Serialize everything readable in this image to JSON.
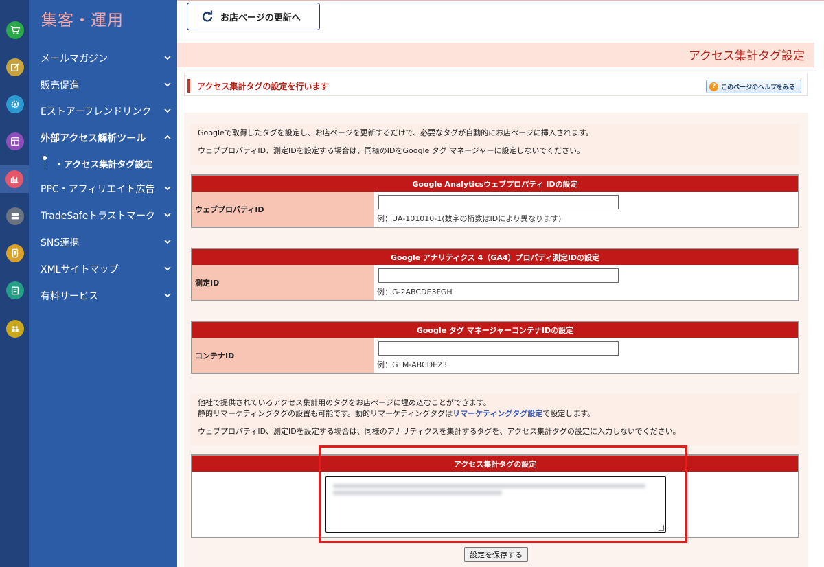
{
  "sidebar": {
    "title": "集客・運用",
    "items": [
      {
        "label": "メールマガジン",
        "expanded": false
      },
      {
        "label": "販売促進",
        "expanded": false
      },
      {
        "label": "Eストアーフレンドリンク",
        "expanded": false
      },
      {
        "label": "外部アクセス解析ツール",
        "expanded": true
      },
      {
        "label": "PPC・アフィリエイト広告",
        "expanded": false
      },
      {
        "label": "TradeSafeトラストマーク",
        "expanded": false
      },
      {
        "label": "SNS連携",
        "expanded": false
      },
      {
        "label": "XMLサイトマップ",
        "expanded": false
      },
      {
        "label": "有料サービス",
        "expanded": false
      }
    ],
    "active_sub": "・アクセス集計タグ設定"
  },
  "rail_icons": [
    {
      "name": "cart-icon",
      "color": "#2aa84a"
    },
    {
      "name": "edit-icon",
      "color": "#c8a23a"
    },
    {
      "name": "gear-icon",
      "color": "#2a9ad0"
    },
    {
      "name": "layout-icon",
      "color": "#8e4fb8"
    },
    {
      "name": "bar-chart-icon",
      "color": "#e5566a"
    },
    {
      "name": "server-icon",
      "color": "#6b7380"
    },
    {
      "name": "mobile-icon",
      "color": "#d9a128"
    },
    {
      "name": "clipboard-icon",
      "color": "#25a086"
    },
    {
      "name": "users-icon",
      "color": "#c9a81e"
    }
  ],
  "toolbar": {
    "refresh_label": "お店ページの更新へ"
  },
  "page": {
    "heading": "アクセス集計タグ設定",
    "intro": "アクセス集計タグの設定を行います",
    "help_label": "このページのヘルプをみる"
  },
  "notice1": {
    "line1": "Googleで取得したタグを設定し、お店ページを更新するだけで、必要なタグが自動的にお店ページに挿入されます。",
    "line2": "ウェブプロパティID、測定IDを設定する場合は、同様のIDをGoogle タグ マネージャーに設定しないでください。"
  },
  "sections": {
    "ua": {
      "title": "Google Analyticsウェブプロパティ IDの設定",
      "label": "ウェブプロパティID",
      "value": "",
      "example": "例：UA-101010-1(数字の桁数はIDにより異なります)"
    },
    "ga4": {
      "title": "Google アナリティクス 4（GA4）プロパティ測定IDの設定",
      "label": "測定ID",
      "value": "",
      "example": "例：G-2ABCDE3FGH"
    },
    "gtm": {
      "title": "Google タグ マネージャーコンテナIDの設定",
      "label": "コンテナID",
      "value": "",
      "example": "例：GTM-ABCDE23"
    }
  },
  "notice2": {
    "line1": "他社で提供されているアクセス集計用のタグをお店ページに埋め込むことができます。",
    "line2_pre": "静的リマーケティングタグの設置も可能です。動的リマーケティングタグは",
    "line2_link": "リマーケティングタグ設定",
    "line2_post": "で設定します。",
    "line3": "ウェブプロパティID、測定IDを設定する場合は、同様のアナリティクスを集計するタグを、アクセス集計タグの設定に入力しないでください。"
  },
  "tag_setting": {
    "title": "アクセス集計タグの設定"
  },
  "save_label": "設定を保存する",
  "colors": {
    "accent_red": "#c11818",
    "sidebar": "#2d5ca7",
    "rail": "#21427a",
    "highlight": "#e01e1e"
  }
}
